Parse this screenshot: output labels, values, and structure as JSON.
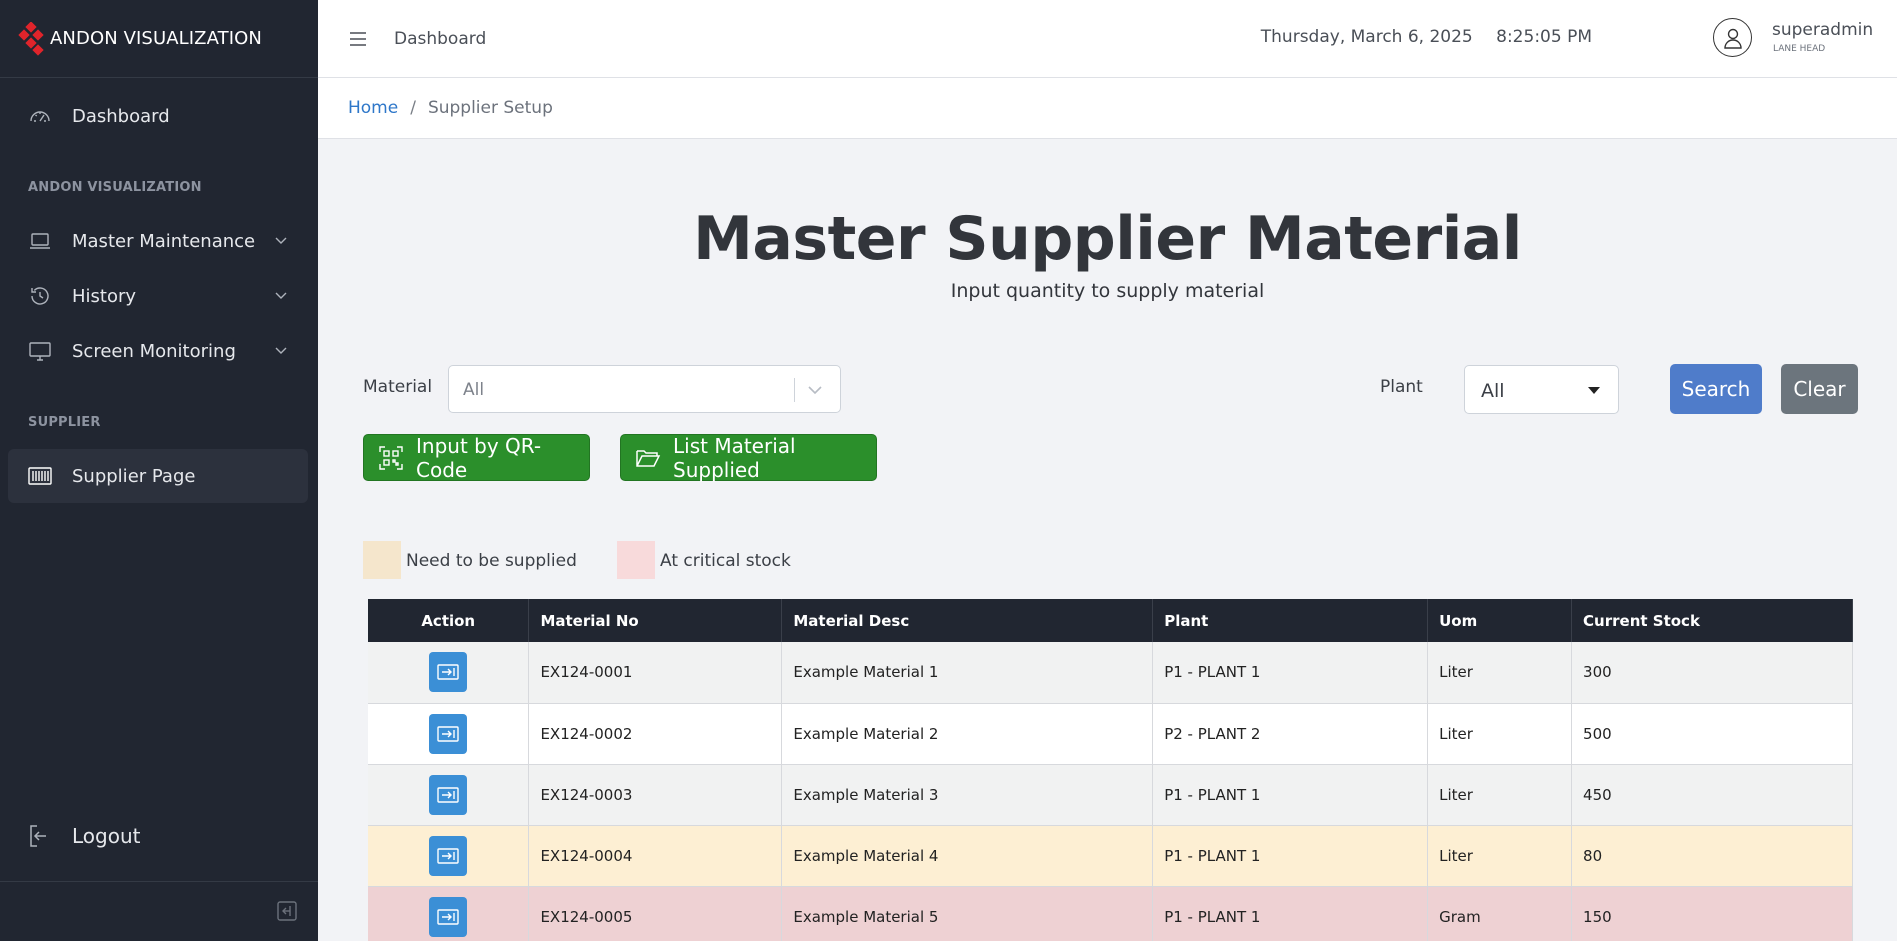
{
  "brand": {
    "name": "ANDON VISUALIZATION",
    "logo_color": "#e0242b"
  },
  "sidebar": {
    "dashboard": "Dashboard",
    "section1": "ANDON VISUALIZATION",
    "items": [
      {
        "label": "Master Maintenance",
        "icon": "laptop-icon"
      },
      {
        "label": "History",
        "icon": "history-icon"
      },
      {
        "label": "Screen Monitoring",
        "icon": "monitor-icon"
      }
    ],
    "section2": "SUPPLIER",
    "supplier_page": "Supplier Page",
    "logout": "Logout"
  },
  "header": {
    "title": "Dashboard",
    "date": "Thursday, March 6, 2025",
    "time": "8:25:05 PM",
    "user_name": "superadmin",
    "user_role": "LANE HEAD"
  },
  "breadcrumb": {
    "home": "Home",
    "separator": "/",
    "current": "Supplier Setup"
  },
  "page": {
    "title": "Master Supplier Material",
    "subtitle": "Input quantity to supply material"
  },
  "filters": {
    "material_label": "Material",
    "material_value": "All",
    "plant_label": "Plant",
    "plant_value": "All",
    "search": "Search",
    "clear": "Clear"
  },
  "actions": {
    "qr": "Input by QR-Code",
    "list": "List Material Supplied"
  },
  "legend": {
    "need": "Need to be supplied",
    "need_color": "#f5e6cc",
    "critical": "At critical stock",
    "critical_color": "#f8dadb"
  },
  "table": {
    "headers": [
      "Action",
      "Material No",
      "Material Desc",
      "Plant",
      "Uom",
      "Current Stock"
    ],
    "rows": [
      {
        "material_no": "EX124-0001",
        "desc": "Example Material 1",
        "plant": "P1 - PLANT 1",
        "uom": "Liter",
        "stock": "300"
      },
      {
        "material_no": "EX124-0002",
        "desc": "Example Material 2",
        "plant": "P2 - PLANT 2",
        "uom": "Liter",
        "stock": "500"
      },
      {
        "material_no": "EX124-0003",
        "desc": "Example Material 3",
        "plant": "P1 - PLANT 1",
        "uom": "Liter",
        "stock": "450"
      },
      {
        "material_no": "EX124-0004",
        "desc": "Example Material 4",
        "plant": "P1 - PLANT 1",
        "uom": "Liter",
        "stock": "80"
      },
      {
        "material_no": "EX124-0005",
        "desc": "Example Material 5",
        "plant": "P1 - PLANT 1",
        "uom": "Gram",
        "stock": "150"
      }
    ]
  }
}
